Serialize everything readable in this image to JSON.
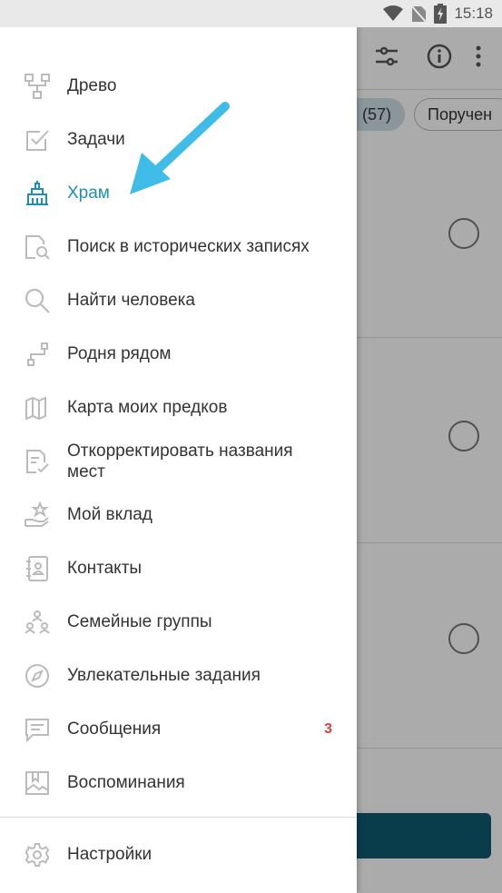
{
  "status": {
    "time": "15:18"
  },
  "background": {
    "chip_count": "(57)",
    "chip_label": "Поручен"
  },
  "drawer": {
    "items": [
      {
        "label": "Древо",
        "icon": "tree-icon"
      },
      {
        "label": "Задачи",
        "icon": "checkbox-icon"
      },
      {
        "label": "Храм",
        "icon": "temple-icon",
        "selected": true
      },
      {
        "label": "Поиск в исторических записях",
        "icon": "record-search-icon"
      },
      {
        "label": "Найти человека",
        "icon": "search-icon"
      },
      {
        "label": "Родня рядом",
        "icon": "relatives-nearby-icon"
      },
      {
        "label": "Карта моих предков",
        "icon": "map-icon"
      },
      {
        "label": "Откорректировать названия мест",
        "icon": "document-check-icon"
      },
      {
        "label": "Мой вклад",
        "icon": "contribution-icon"
      },
      {
        "label": "Контакты",
        "icon": "contacts-icon"
      },
      {
        "label": "Семейные группы",
        "icon": "family-groups-icon"
      },
      {
        "label": "Увлекательные задания",
        "icon": "compass-icon"
      },
      {
        "label": "Сообщения",
        "icon": "message-icon",
        "badge": "3"
      },
      {
        "label": "Воспоминания",
        "icon": "memories-icon"
      }
    ],
    "settings_label": "Настройки"
  },
  "colors": {
    "accent": "#1d8fb1",
    "badge": "#e33d3d",
    "arrow": "#3fbde8"
  }
}
